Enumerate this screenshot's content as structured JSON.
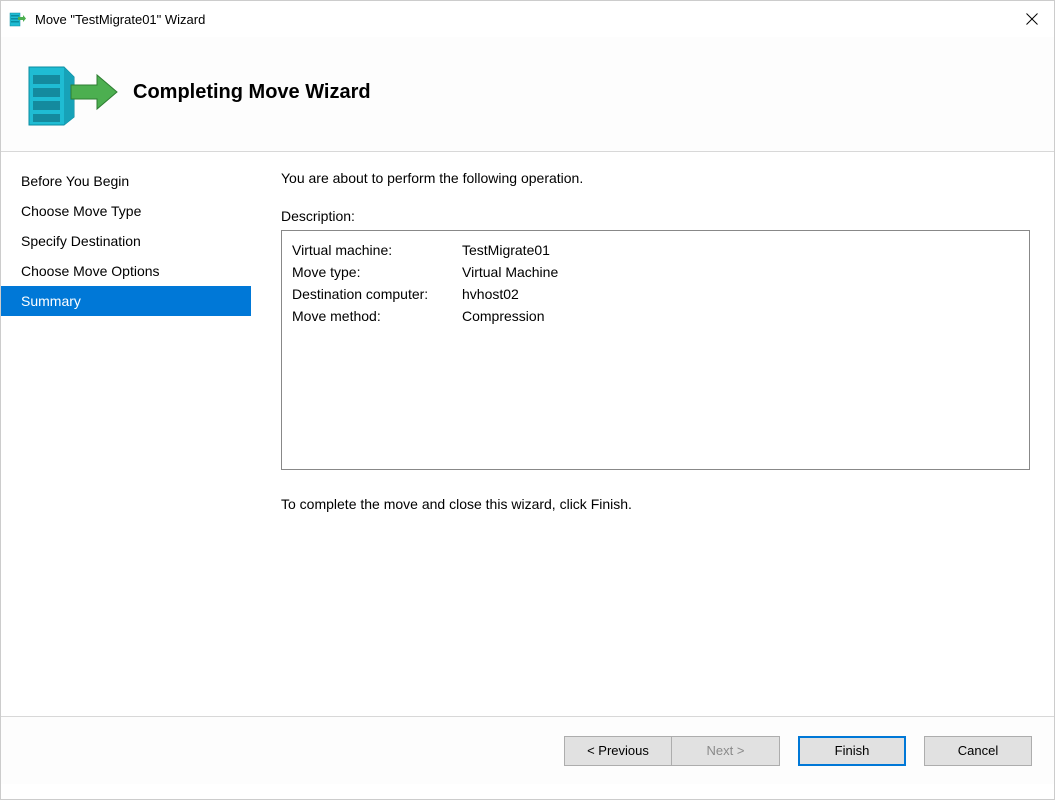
{
  "titlebar": {
    "title": "Move \"TestMigrate01\" Wizard"
  },
  "header": {
    "title": "Completing Move Wizard"
  },
  "sidebar": {
    "items": [
      {
        "label": "Before You Begin",
        "selected": false
      },
      {
        "label": "Choose Move Type",
        "selected": false
      },
      {
        "label": "Specify Destination",
        "selected": false
      },
      {
        "label": "Choose Move Options",
        "selected": false
      },
      {
        "label": "Summary",
        "selected": true
      }
    ]
  },
  "main": {
    "intro_text": "You are about to perform the following operation.",
    "description_label": "Description:",
    "details": [
      {
        "label": "Virtual machine:",
        "value": "TestMigrate01"
      },
      {
        "label": "Move type:",
        "value": "Virtual Machine"
      },
      {
        "label": "Destination computer:",
        "value": "hvhost02"
      },
      {
        "label": "Move method:",
        "value": "Compression"
      }
    ],
    "completion_text": "To complete the move and close this wizard, click Finish."
  },
  "buttons": {
    "previous": "< Previous",
    "next": "Next >",
    "finish": "Finish",
    "cancel": "Cancel"
  }
}
